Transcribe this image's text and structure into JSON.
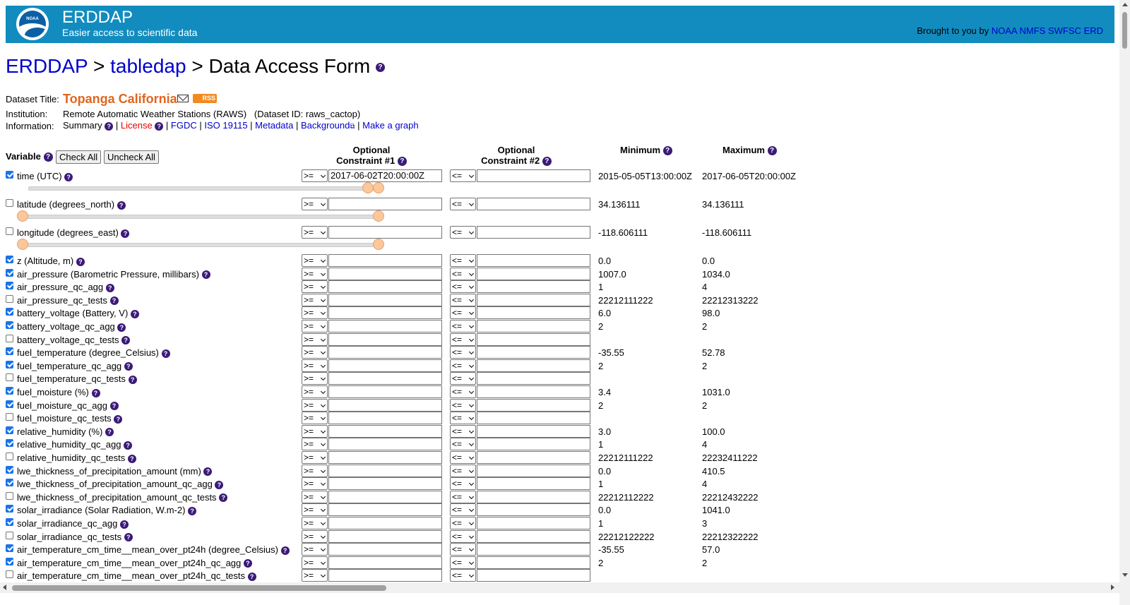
{
  "banner": {
    "logo_text": "NOAA",
    "title": "ERDDAP",
    "subtitle": "Easier access to scientific data",
    "brought_prefix": "Brought to you by",
    "brought_links": [
      "NOAA",
      "NMFS",
      "SWFSC",
      "ERD"
    ],
    "bg_color": "#128cbf"
  },
  "breadcrumb": {
    "erddap": "ERDDAP",
    "sep": ">",
    "tabledap": "tabledap",
    "page": "Data Access Form"
  },
  "dataset": {
    "title_label": "Dataset Title:",
    "title": "Topanga California",
    "rss": "RSS",
    "institution_label": "Institution:",
    "institution": "Remote Automatic Weather Stations (RAWS)   (Dataset ID: raws_cactop)",
    "information_label": "Information:",
    "info_links": {
      "summary": "Summary",
      "license": "License",
      "fgdc": "FGDC",
      "iso": "ISO 19115",
      "metadata": "Metadata",
      "background": "Background",
      "graph": "Make a graph"
    }
  },
  "table": {
    "variable_header": "Variable",
    "check_all": "Check All",
    "uncheck_all": "Uncheck All",
    "c1_line1": "Optional",
    "c1_line2": "Constraint #1",
    "c2_line1": "Optional",
    "c2_line2": "Constraint #2",
    "min_header": "Minimum",
    "max_header": "Maximum",
    "op1": ">=",
    "op2": "<=",
    "rows": [
      {
        "label": "time (UTC)",
        "checked": true,
        "c1": "2017-06-02T20:00:00Z",
        "min": "2015-05-05T13:00:00Z",
        "max": "2017-06-05T20:00:00Z",
        "slider": true
      },
      {
        "label": "latitude (degrees_north)",
        "checked": false,
        "c1": "",
        "min": "34.136111",
        "max": "34.136111",
        "slider": true
      },
      {
        "label": "longitude (degrees_east)",
        "checked": false,
        "c1": "",
        "min": "-118.606111",
        "max": "-118.606111",
        "slider": true
      },
      {
        "label": "z (Altitude, m)",
        "checked": true,
        "c1": "",
        "min": "0.0",
        "max": "0.0"
      },
      {
        "label": "air_pressure (Barometric Pressure, millibars)",
        "checked": true,
        "c1": "",
        "min": "1007.0",
        "max": "1034.0"
      },
      {
        "label": "air_pressure_qc_agg",
        "checked": true,
        "c1": "",
        "min": "1",
        "max": "4"
      },
      {
        "label": "air_pressure_qc_tests",
        "checked": false,
        "c1": "",
        "min": "22212111222",
        "max": "22212313222"
      },
      {
        "label": "battery_voltage (Battery, V)",
        "checked": true,
        "c1": "",
        "min": "6.0",
        "max": "98.0"
      },
      {
        "label": "battery_voltage_qc_agg",
        "checked": true,
        "c1": "",
        "min": "2",
        "max": "2"
      },
      {
        "label": "battery_voltage_qc_tests",
        "checked": false,
        "c1": "",
        "min": "",
        "max": ""
      },
      {
        "label": "fuel_temperature (degree_Celsius)",
        "checked": true,
        "c1": "",
        "min": "-35.55",
        "max": "52.78"
      },
      {
        "label": "fuel_temperature_qc_agg",
        "checked": true,
        "c1": "",
        "min": "2",
        "max": "2"
      },
      {
        "label": "fuel_temperature_qc_tests",
        "checked": false,
        "c1": "",
        "min": "",
        "max": ""
      },
      {
        "label": "fuel_moisture (%)",
        "checked": true,
        "c1": "",
        "min": "3.4",
        "max": "1031.0"
      },
      {
        "label": "fuel_moisture_qc_agg",
        "checked": true,
        "c1": "",
        "min": "2",
        "max": "2"
      },
      {
        "label": "fuel_moisture_qc_tests",
        "checked": false,
        "c1": "",
        "min": "",
        "max": ""
      },
      {
        "label": "relative_humidity (%)",
        "checked": true,
        "c1": "",
        "min": "3.0",
        "max": "100.0"
      },
      {
        "label": "relative_humidity_qc_agg",
        "checked": true,
        "c1": "",
        "min": "1",
        "max": "4"
      },
      {
        "label": "relative_humidity_qc_tests",
        "checked": false,
        "c1": "",
        "min": "22212111222",
        "max": "22232411222"
      },
      {
        "label": "lwe_thickness_of_precipitation_amount (mm)",
        "checked": true,
        "c1": "",
        "min": "0.0",
        "max": "410.5"
      },
      {
        "label": "lwe_thickness_of_precipitation_amount_qc_agg",
        "checked": true,
        "c1": "",
        "min": "1",
        "max": "4"
      },
      {
        "label": "lwe_thickness_of_precipitation_amount_qc_tests",
        "checked": false,
        "c1": "",
        "min": "22212112222",
        "max": "22212432222"
      },
      {
        "label": "solar_irradiance (Solar Radiation, W.m-2)",
        "checked": true,
        "c1": "",
        "min": "0.0",
        "max": "1041.0"
      },
      {
        "label": "solar_irradiance_qc_agg",
        "checked": true,
        "c1": "",
        "min": "1",
        "max": "3"
      },
      {
        "label": "solar_irradiance_qc_tests",
        "checked": false,
        "c1": "",
        "min": "22212122222",
        "max": "22212322222"
      },
      {
        "label": "air_temperature_cm_time__mean_over_pt24h (degree_Celsius)",
        "checked": true,
        "c1": "",
        "min": "-35.55",
        "max": "57.0"
      },
      {
        "label": "air_temperature_cm_time__mean_over_pt24h_qc_agg",
        "checked": true,
        "c1": "",
        "min": "2",
        "max": "2"
      },
      {
        "label": "air_temperature_cm_time__mean_over_pt24h_qc_tests",
        "checked": false,
        "c1": "",
        "min": "",
        "max": ""
      }
    ]
  }
}
